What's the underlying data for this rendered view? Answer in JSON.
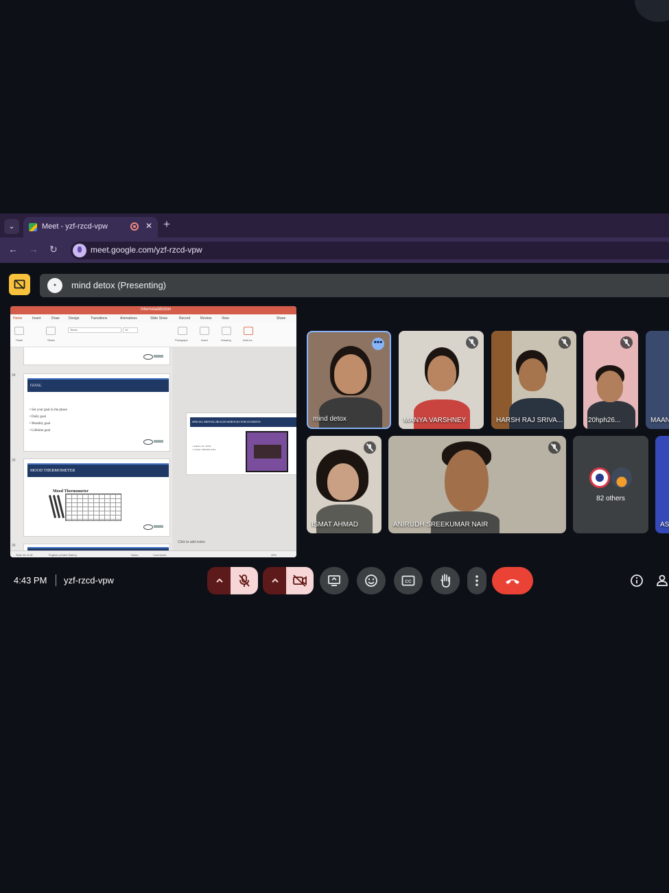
{
  "browser": {
    "tab_title": "Meet - yzf-rzcd-vpw",
    "tab_close": "✕",
    "new_tab": "+",
    "url": "meet.google.com/yzf-rzcd-vpw"
  },
  "meet": {
    "presenter_label": "mind detox (Presenting)",
    "time": "4:43 PM",
    "meeting_code": "yzf-rzcd-vpw"
  },
  "slides_app": {
    "file_name": "Internetaddiction",
    "menu": [
      "Home",
      "Insert",
      "Draw",
      "Design",
      "Transitions",
      "Animations",
      "Slide Show",
      "Record",
      "Review",
      "View"
    ],
    "share": "Share",
    "font_name": "Times",
    "font_size": "10",
    "ribbon_groups": [
      "Paste",
      "Slides",
      "Paragraph",
      "Insert",
      "Drawing",
      "Add-ins"
    ],
    "slides": [
      {
        "number": "34",
        "title": "GOAL",
        "bullets": [
          "Set your goal in the phase",
          "Daily goal",
          "Monthly goal",
          "Lifetime goal"
        ]
      },
      {
        "number": "35",
        "title": "MOOD THERMOMETER",
        "image_caption": "Mood Thermometer"
      },
      {
        "number": "36"
      }
    ],
    "current_slide": {
      "title": "SPECIAL MENTAL HEALTH SERVICES FOR STUDENTS",
      "lines": [
        "Helpline No: 14416",
        "Contact: 1800-891-4416"
      ]
    },
    "notes_placeholder": "Click to add notes",
    "status": {
      "slide_count": "Slide 46 of 48",
      "language": "English (United States)",
      "notes": "Notes",
      "comments": "Comments",
      "zoom": "39%"
    }
  },
  "participants": [
    {
      "name": "mind detox",
      "muted": false
    },
    {
      "name": "MANYA VARSHNEY",
      "muted": true
    },
    {
      "name": "HARSH RAJ SRIVA...",
      "muted": true
    },
    {
      "name": "20hph26...",
      "muted": true
    },
    {
      "name": "MAAN",
      "muted": false
    },
    {
      "name": "ISMAT AHMAD",
      "muted": true
    },
    {
      "name": "ANIRUDH SREEKUMAR NAIR",
      "muted": true
    },
    {
      "name": "AS",
      "muted": false
    }
  ],
  "others_count": "82 others",
  "colors": {
    "page_bg": "#0d1017",
    "presenting_accent": "#f9c23c",
    "hangup": "#ea4335",
    "browser_tab": "#3a2d55",
    "active_speaker_border": "#8ab4f8"
  },
  "icons": {
    "tab_menu": "chevron-down-icon",
    "back": "arrow-left-icon",
    "forward": "arrow-right-icon",
    "reload": "reload-icon",
    "mic_toggle": "mic-off-icon",
    "camera_toggle": "camera-off-icon",
    "present": "present-screen-icon",
    "emoji": "emoji-icon",
    "captions": "captions-icon",
    "raise_hand": "hand-icon",
    "more": "more-vert-icon",
    "leave": "call-end-icon",
    "info": "info-icon",
    "people": "people-icon"
  }
}
